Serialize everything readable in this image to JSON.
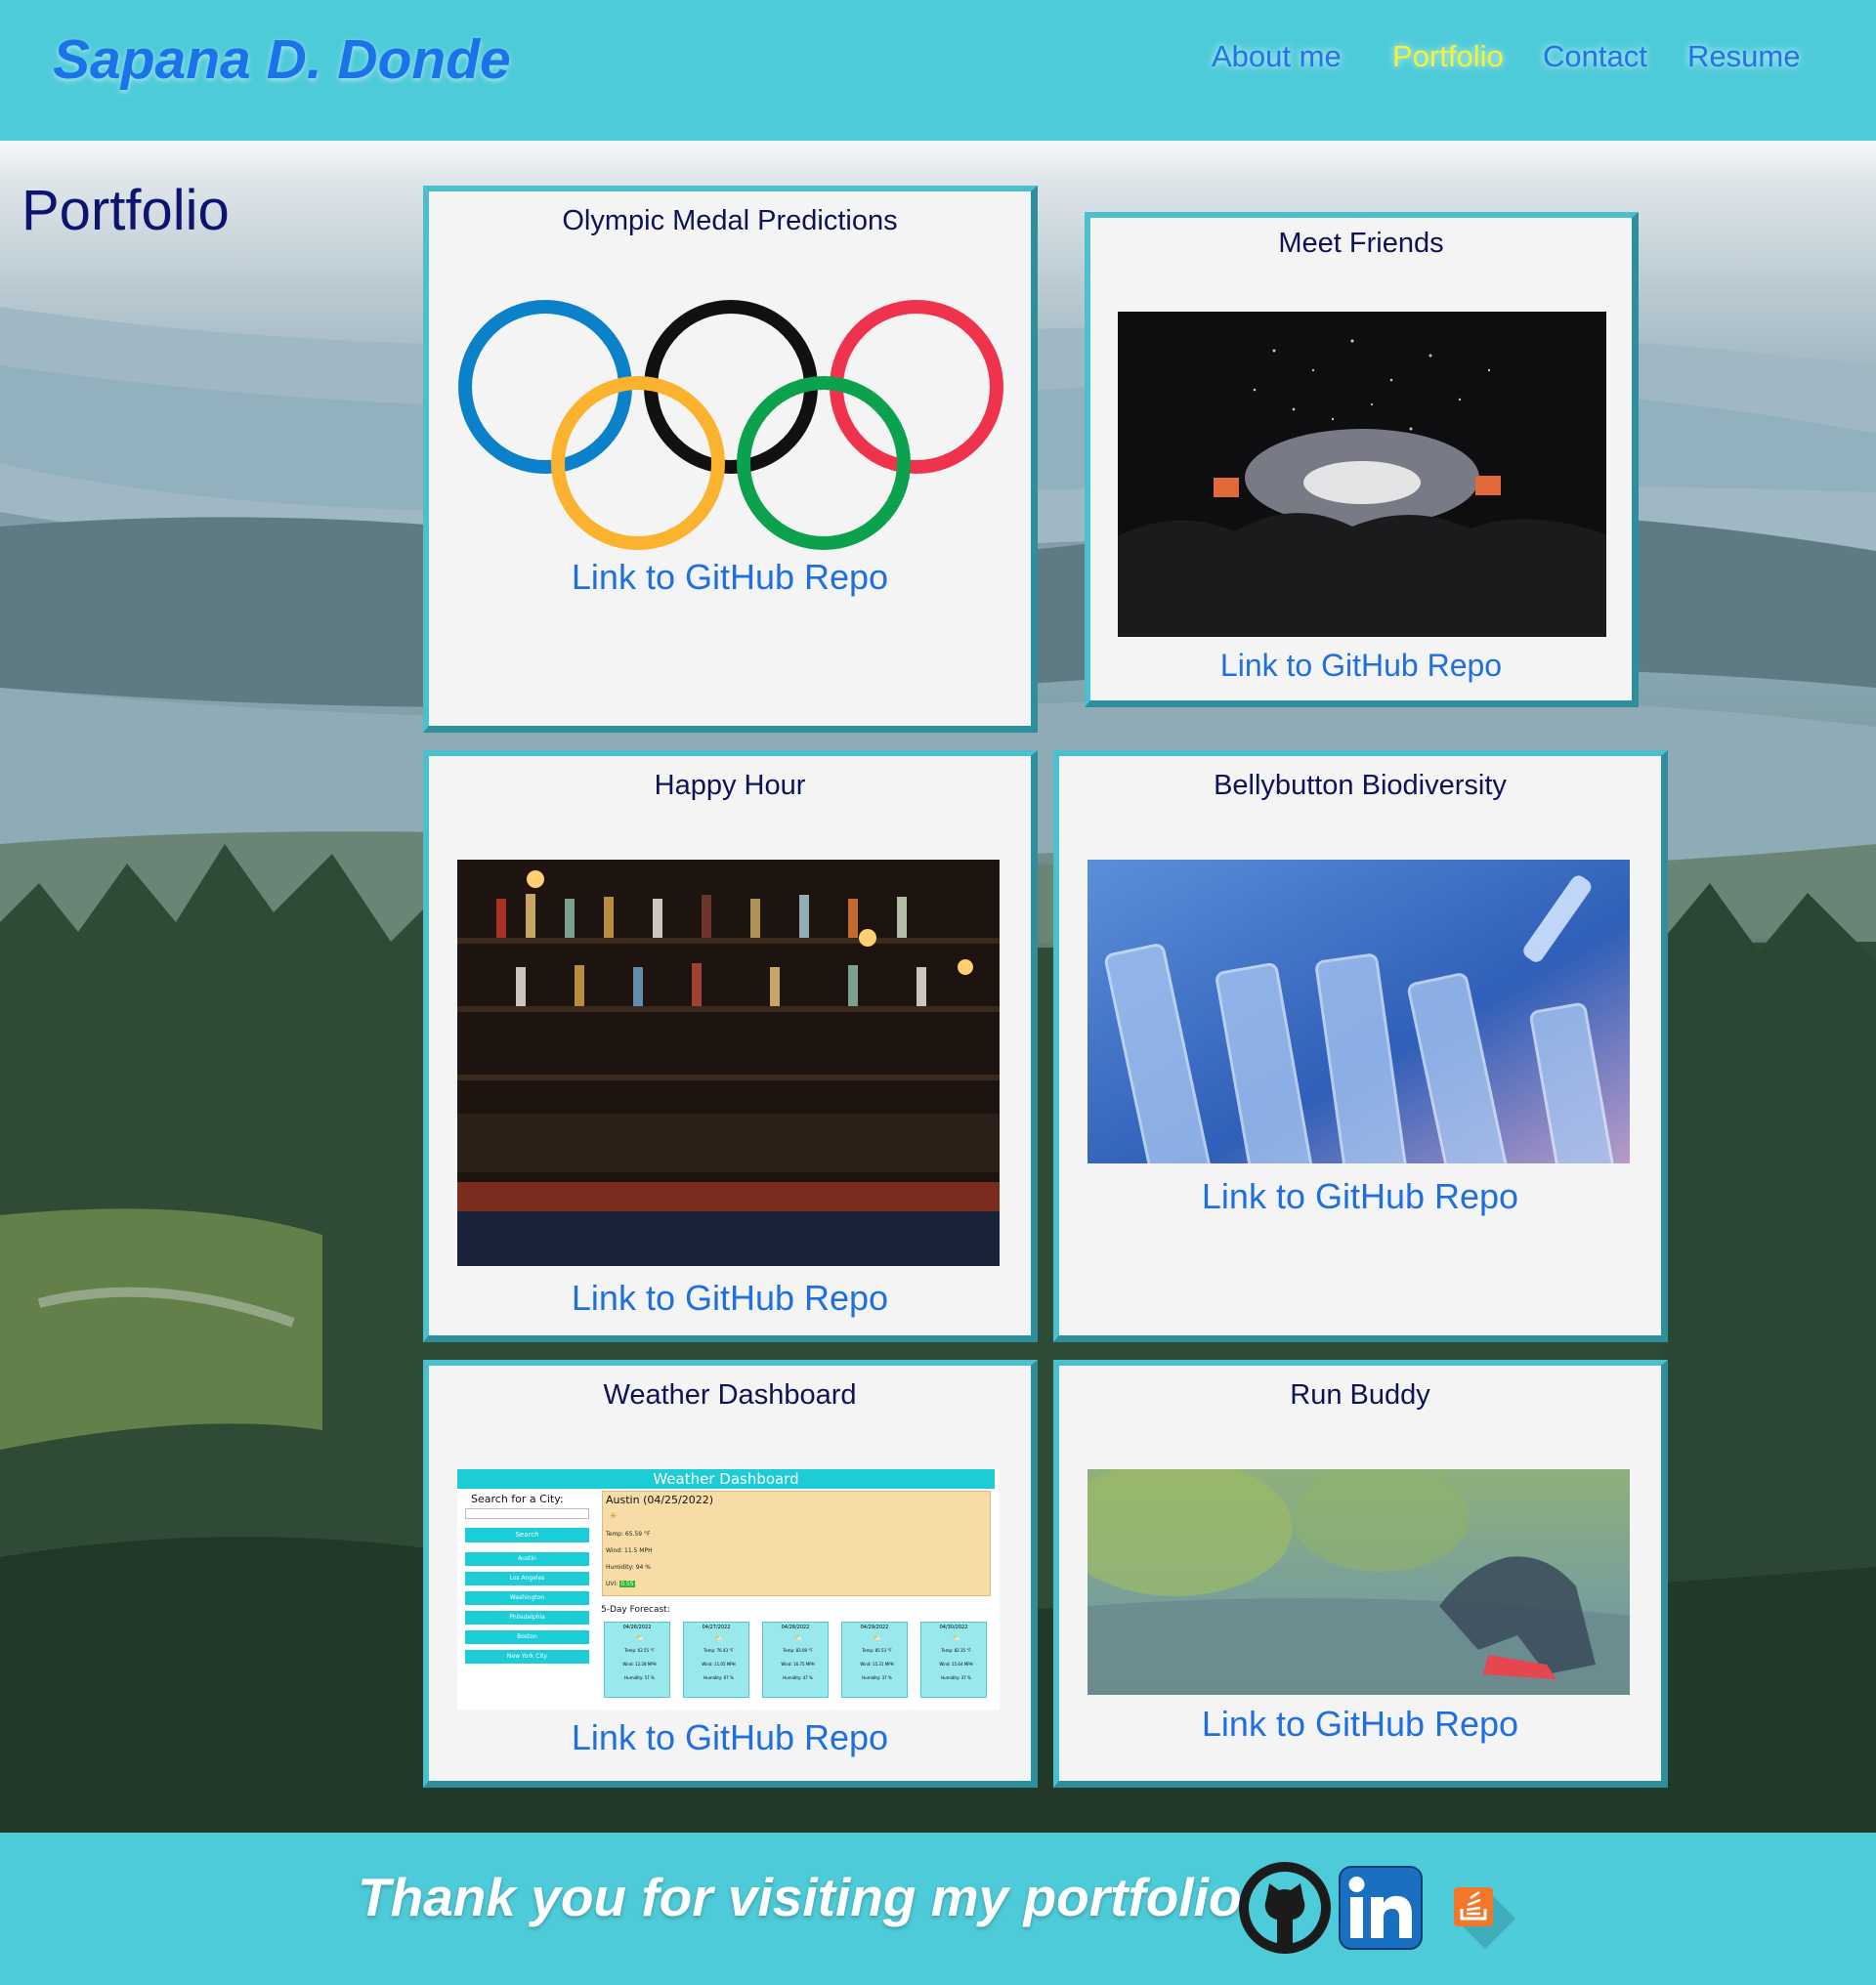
{
  "header": {
    "brand": "Sapana D. Donde",
    "nav": [
      {
        "label": "About me",
        "active": false
      },
      {
        "label": "Portfolio",
        "active": true
      },
      {
        "label": "Contact",
        "active": false
      },
      {
        "label": "Resume",
        "active": false
      }
    ]
  },
  "page": {
    "heading": "Portfolio"
  },
  "projects": [
    {
      "title": "Olympic Medal Predictions",
      "link": "Link to GitHub Repo"
    },
    {
      "title": "Meet Friends",
      "link": "Link to GitHub Repo"
    },
    {
      "title": "Happy Hour",
      "link": "Link to GitHub Repo"
    },
    {
      "title": "Bellybutton Biodiversity",
      "link": "Link to GitHub Repo"
    },
    {
      "title": "Weather Dashboard",
      "link": "Link to GitHub Repo"
    },
    {
      "title": "Run Buddy",
      "link": "Link to GitHub Repo"
    }
  ],
  "weather_preview": {
    "header": "Weather Dashboard",
    "search_label": "Search for a City:",
    "search_button": "Search",
    "cities": [
      "Austin",
      "Los Angeles",
      "Washington",
      "Philadelphia",
      "Boston",
      "New York City"
    ],
    "current_title": "Austin (04/25/2022)",
    "current_lines": [
      "Temp: 65.59 °F",
      "Wind: 11.5 MPH",
      "Humidity: 94 %"
    ],
    "uvi_label": "UVI:",
    "uvi_value": "0.55",
    "forecast_label": "5-Day Forecast:",
    "forecast": [
      {
        "date": "04/26/2022",
        "temp": "Temp: 63.55 °F",
        "wind": "Wind: 12.28 MPH",
        "humidity": "Humidity: 57 %"
      },
      {
        "date": "04/27/2022",
        "temp": "Temp: 76.43 °F",
        "wind": "Wind: 11.05 MPH",
        "humidity": "Humidity: 67 %"
      },
      {
        "date": "04/28/2022",
        "temp": "Temp: 83.09 °F",
        "wind": "Wind: 16.75 MPH",
        "humidity": "Humidity: 47 %"
      },
      {
        "date": "04/29/2022",
        "temp": "Temp: 85.53 °F",
        "wind": "Wind: 15.31 MPH",
        "humidity": "Humidity: 37 %"
      },
      {
        "date": "04/30/2022",
        "temp": "Temp: 82.35 °F",
        "wind": "Wind: 15.64 MPH",
        "humidity": "Humidity: 37 %"
      }
    ]
  },
  "footer": {
    "thanks": "Thank you for visiting my portfolio!"
  },
  "icons": {
    "github": "github-icon",
    "linkedin": "linkedin-icon",
    "stackoverflow": "stackoverflow-icon"
  },
  "colors": {
    "header_bg": "#4ecbd8",
    "brand": "#1a73e8",
    "nav_link": "#1f74ea",
    "nav_active": "#f5f52b",
    "card_border": "#4bbfcc",
    "card_title": "#0e1357",
    "link": "#1f6fe0"
  }
}
